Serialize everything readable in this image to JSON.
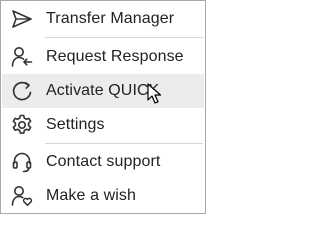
{
  "menu": {
    "items": [
      {
        "id": "transfer-manager",
        "label": "Transfer Manager",
        "icon": "send-arrow-icon"
      },
      {
        "id": "request-response",
        "label": "Request Response",
        "icon": "user-arrow-icon"
      },
      {
        "id": "activate-quick",
        "label": "Activate QUICK",
        "icon": "circle-refresh-icon"
      },
      {
        "id": "settings",
        "label": "Settings",
        "icon": "gear-icon"
      },
      {
        "id": "contact-support",
        "label": "Contact support",
        "icon": "headset-icon"
      },
      {
        "id": "make-a-wish",
        "label": "Make a wish",
        "icon": "user-heart-icon"
      }
    ],
    "hovered_item": "activate-quick"
  },
  "colors": {
    "border": "#a8a8a8",
    "text": "#222222",
    "icon": "#333333",
    "hover_background": "#ececec",
    "separator": "#d6d6d6"
  }
}
